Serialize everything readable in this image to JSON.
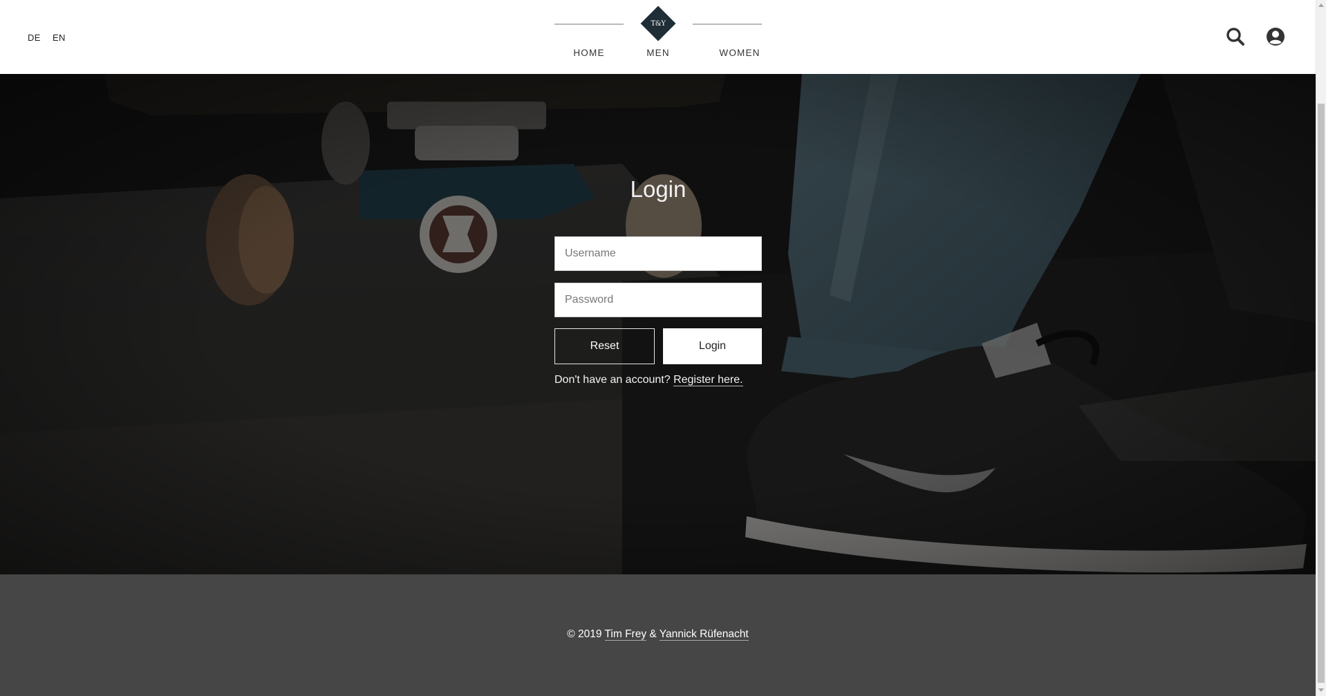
{
  "header": {
    "languages": [
      "DE",
      "EN"
    ],
    "logo_text": "T&Y",
    "nav": [
      "HOME",
      "MEN",
      "WOMEN"
    ],
    "icons": [
      "search-icon",
      "user-icon"
    ]
  },
  "login": {
    "title": "Login",
    "username_placeholder": "Username",
    "password_placeholder": "Password",
    "reset_label": "Reset",
    "login_label": "Login",
    "register_prompt": "Don't have an account?",
    "register_link": "Register here."
  },
  "footer": {
    "prefix": "© 2019",
    "author1": "Tim Frey",
    "separator": "&",
    "author2": "Yannick Rüfenacht"
  },
  "colors": {
    "header_bg": "#ffffff",
    "logo": "#1e2d36",
    "footer_bg": "#464646",
    "hero_overlay": "#1b1b1c"
  }
}
